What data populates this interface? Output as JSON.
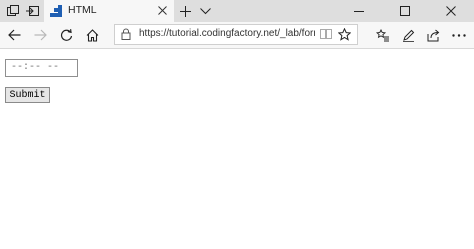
{
  "tab": {
    "title": "HTML"
  },
  "address_bar": {
    "url": "https://tutorial.codingfactory.net/_lab/form.htm"
  },
  "page": {
    "time_input_value": "--:-- --",
    "submit_label": "Submit"
  },
  "colors": {
    "titlebar": "#dedede",
    "toolbar": "#f7f7f7",
    "favicon": "#1f5fb3"
  }
}
